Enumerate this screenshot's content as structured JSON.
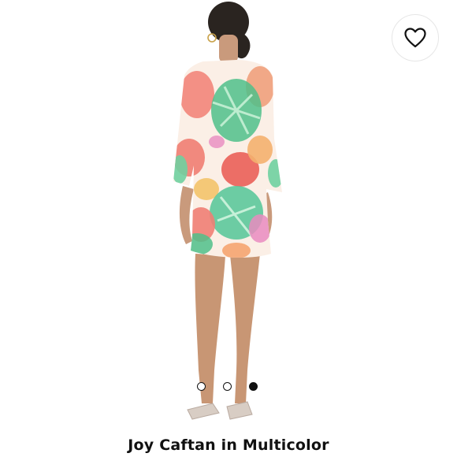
{
  "product": {
    "title": "Joy Caftan in Multicolor",
    "image_alt": "Model wearing a tropical print caftan dress, back view"
  },
  "carousel": {
    "total_images": 3,
    "active_index": 2
  },
  "favorite": {
    "icon": "heart-outline-icon",
    "label": "Add to favorites"
  },
  "colors": {
    "text": "#111111",
    "dot_active": "#111111",
    "background": "#ffffff"
  }
}
